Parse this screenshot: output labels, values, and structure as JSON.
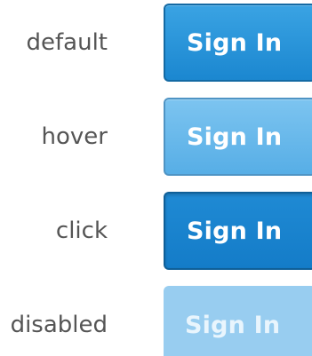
{
  "states": {
    "default": {
      "label": "default",
      "button_label": "Sign In"
    },
    "hover": {
      "label": "hover",
      "button_label": "Sign In"
    },
    "click": {
      "label": "click",
      "button_label": "Sign In"
    },
    "disabled": {
      "label": "disabled",
      "button_label": "Sign In"
    }
  },
  "colors": {
    "default_fill": "#2196dc",
    "hover_fill": "#6bbcec",
    "click_fill": "#1782cc",
    "disabled_fill": "#98cdf0",
    "label_text": "#555555",
    "button_text": "#ffffff"
  }
}
